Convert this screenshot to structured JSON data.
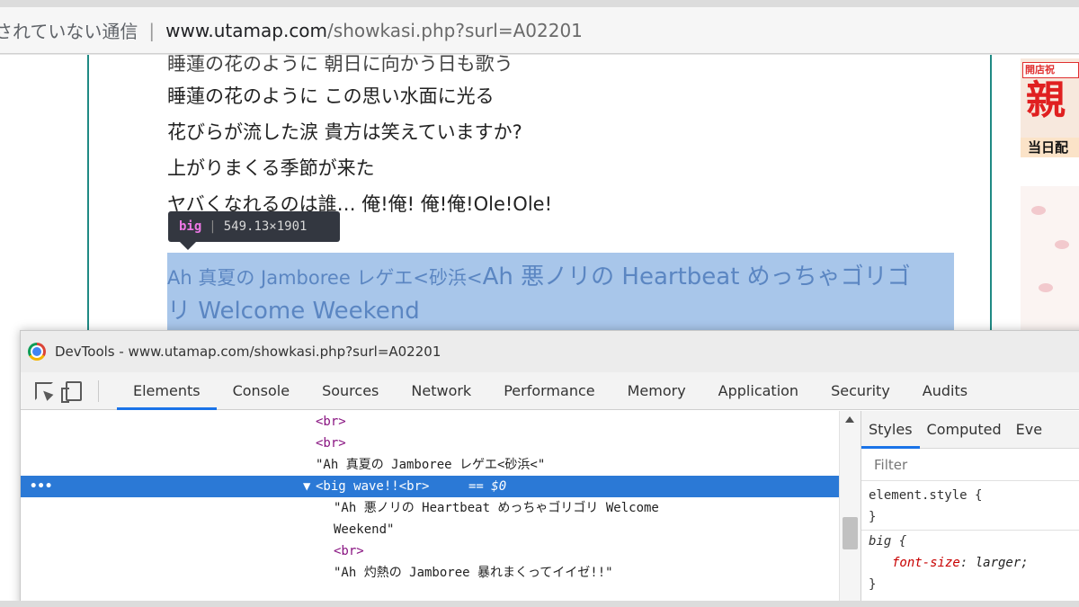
{
  "address_bar": {
    "security_text": "されていない通信",
    "separator": "|",
    "host": "www.utamap.com",
    "path": "/showkasi.php?surl=A02201"
  },
  "lyrics": {
    "cut_line": "睡蓮の花のように 朝日に向かう日も歌う",
    "lines": [
      "睡蓮の花のように この思い水面に光る",
      "花びらが流した涙 貴方は笑えていますか?",
      "上がりまくる季節が来た",
      "ヤバくなれるのは誰… 俺!俺! 俺!俺!Ole!Ole!"
    ],
    "highlight": {
      "line1_small": "Ah 真夏の Jamboree レゲエ<砂浜<",
      "line1_large": "Ah 悪ノリの Heartbeat めっちゃゴリゴ",
      "line2_large": "リ Welcome Weekend"
    }
  },
  "tooltip": {
    "tag": "big",
    "separator": "|",
    "dimensions": "549.13×1901"
  },
  "ad": {
    "badge": "開店祝",
    "big_char": "親",
    "strip": "当日配"
  },
  "devtools": {
    "title": "DevTools - www.utamap.com/showkasi.php?surl=A02201",
    "tabs": [
      "Elements",
      "Console",
      "Sources",
      "Network",
      "Performance",
      "Memory",
      "Application",
      "Security",
      "Audits"
    ],
    "dom_lines": [
      "<br>",
      "<br>",
      "\"Ah 真夏の Jamboree レゲエ<砂浜<\"",
      "<big wave!!<br>",
      "\"Ah 悪ノリの Heartbeat めっちゃゴリゴリ Welcome",
      "Weekend\"",
      "<br>",
      "\"Ah 灼熱の Jamboree 暴れまくってイイゼ!!\""
    ],
    "selected_marker": "== $0",
    "selected_arrow": "▼",
    "row_dots": "•••",
    "styles": {
      "tabs": [
        "Styles",
        "Computed",
        "Eve"
      ],
      "filter_placeholder": "Filter",
      "element_style_open": "element.style {",
      "element_style_close": "}",
      "rule_selector": "big {",
      "rule_prop": "font-size",
      "rule_value": "larger;",
      "rule_close": "}"
    }
  },
  "colors": {
    "selection_blue": "#2b79d6",
    "highlight_overlay": "#a8c6ea",
    "frame_teal": "#1f8a84",
    "tag_purple": "#881280"
  }
}
